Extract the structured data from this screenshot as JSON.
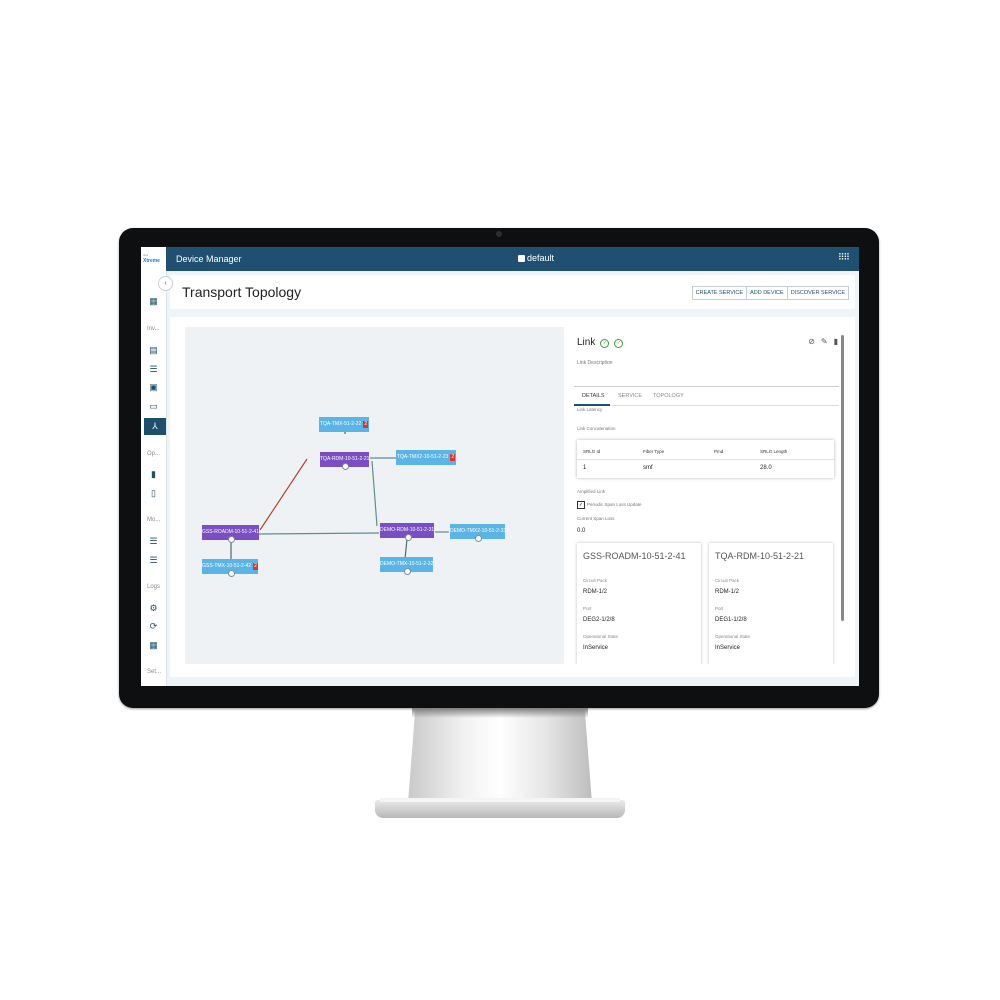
{
  "topbar": {
    "title": "Device Manager",
    "workspace": "default",
    "apps_icon": "grid-icon"
  },
  "sidebar": {
    "logo_small": "xtra",
    "logo_big": "Xtreme",
    "sections": [
      "Inv...",
      "Op...",
      "Mo...",
      "Logs",
      "Set..."
    ],
    "collapse_glyph": "‹"
  },
  "page": {
    "title": "Transport Topology"
  },
  "toolbar": {
    "create_service": "CREATE SERVICE",
    "add_device": "ADD DEVICE",
    "discover_service": "DISCOVER SERVICE"
  },
  "topology": {
    "nodes": [
      {
        "id": "n1",
        "label": "TQA-TMX-51-2-22",
        "badge": "2",
        "kind": "tmx"
      },
      {
        "id": "n2",
        "label": "TQA-RDM-10-51-2-21",
        "badge": "",
        "kind": "roadm"
      },
      {
        "id": "n3",
        "label": "TQA-TMX2-10-51-2-23",
        "badge": "2",
        "kind": "tmx"
      },
      {
        "id": "n4",
        "label": "GSS-ROADM-10-51-2-41",
        "badge": "",
        "kind": "roadm"
      },
      {
        "id": "n5",
        "label": "DEMO-RDM-10-51-2-31",
        "badge": "",
        "kind": "roadm"
      },
      {
        "id": "n6",
        "label": "DEMO-TMX2-10-51-2-33",
        "badge": "",
        "kind": "tmx"
      },
      {
        "id": "n7",
        "label": "GSS-TMX-10-51-2-42",
        "badge": "2",
        "kind": "tmx"
      },
      {
        "id": "n8",
        "label": "DEMO-TMX-10-51-2-32",
        "badge": "",
        "kind": "tmx"
      }
    ],
    "colors": {
      "roadm": "#7a4fc3",
      "tmx": "#5ab5e6",
      "alert": "#d33333",
      "link_selected": "#b8432b",
      "link": "#5f8f8a"
    }
  },
  "panel": {
    "title": "Link",
    "status_icons": [
      "check-circle-icon",
      "check-circle-icon"
    ],
    "action_icons": [
      "unlink-icon",
      "edit-icon",
      "delete-icon"
    ],
    "link_description_label": "Link Description",
    "tabs": [
      "DETAILS",
      "SERVICE",
      "TOPOLOGY"
    ],
    "link_latency_label": "Link Latency",
    "link_concatenation_label": "Link Concatenation",
    "srlg": {
      "headers": [
        "SRLG Id",
        "Fiber Type",
        "Pmd",
        "SRLG Length"
      ],
      "row": [
        "1",
        "smf",
        "",
        "28.0"
      ]
    },
    "amplified_link_label": "Amplified Link",
    "periodic_span_label": "Periodic Span Loss Update",
    "periodic_span_checked": true,
    "current_span_loss_label": "Current Span Loss",
    "current_span_loss_value": "0.0",
    "endpoints": [
      {
        "name": "GSS-ROADM-10-51-2-41",
        "circuit_pack_label": "Circuit Pack",
        "circuit_pack": "RDM-1/2",
        "port_label": "Port",
        "port": "DEG2-1/2/8",
        "state_label": "Operational State",
        "state": "InService"
      },
      {
        "name": "TQA-RDM-10-51-2-21",
        "circuit_pack_label": "Circuit Pack",
        "circuit_pack": "RDM-1/2",
        "port_label": "Port",
        "port": "DEG1-1/2/8",
        "state_label": "Operational State",
        "state": "InService"
      }
    ]
  }
}
